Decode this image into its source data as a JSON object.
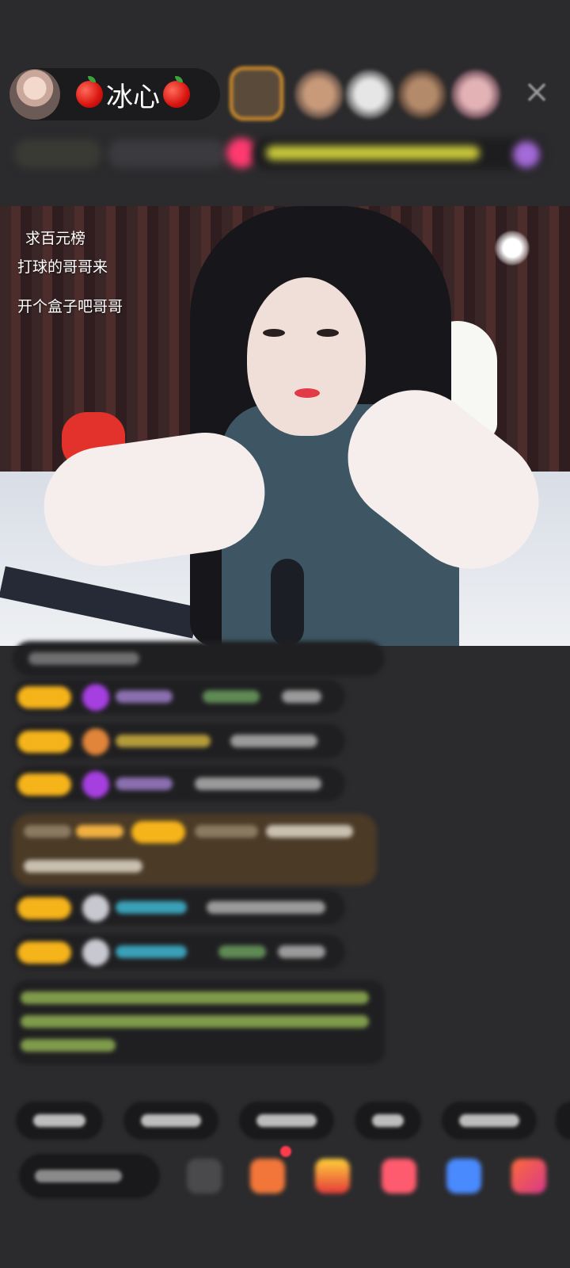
{
  "header": {
    "host_name": "冰心",
    "host_icon_left": "apple-icon",
    "host_icon_right": "apple-icon",
    "close_icon": "close-icon"
  },
  "stream": {
    "overlay_texts": [
      "求百元榜",
      "打球的哥哥来",
      "开个盒子吧哥哥"
    ]
  },
  "colors": {
    "background": "#2b2b2d",
    "pill": "#1b1b1d",
    "badge": "#f6b41b",
    "notification": "#ff3b4e"
  },
  "bottom_bar": {
    "tools": [
      "share-icon",
      "gift-box-icon",
      "red-packet-icon",
      "game-icon",
      "chat-icon",
      "more-icon"
    ]
  }
}
